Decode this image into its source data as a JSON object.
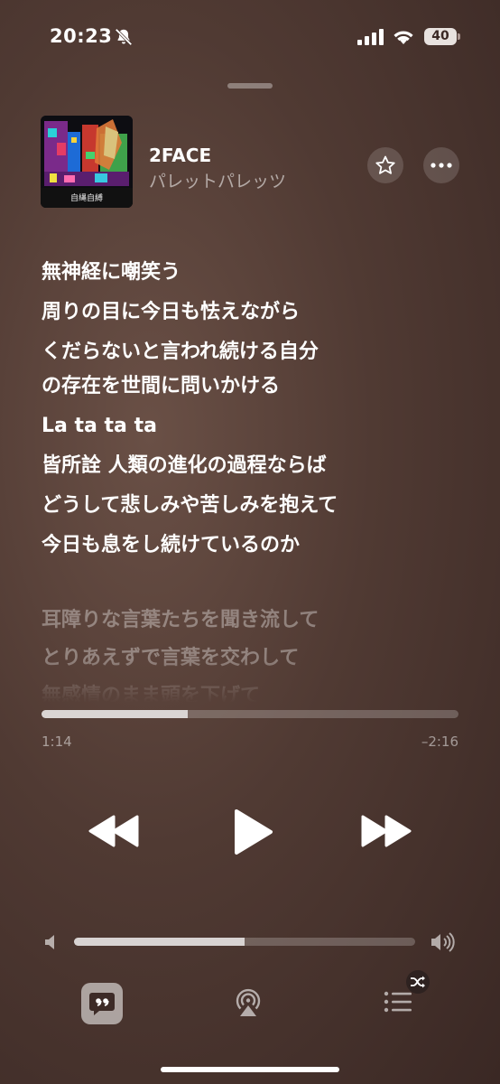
{
  "status_bar": {
    "time": "20:23",
    "battery": "40"
  },
  "track": {
    "title": "2FACE",
    "artist": "パレットパレッツ",
    "artwork_caption": "自縄自縛"
  },
  "lyrics": {
    "active": [
      "無神経に嘲笑う",
      "周りの目に今日も怯えながら",
      "くだらないと言われ続ける自分",
      "の存在を世間に問いかける",
      "La ta ta ta",
      "皆所詮 人類の進化の過程ならば",
      "どうして悲しみや苦しみを抱えて",
      "今日も息をし続けているのか"
    ],
    "upcoming": [
      "耳障りな言葉たちを聞き流して",
      "とりあえずで言葉を交わして",
      "無感情のまま頭を下げて"
    ]
  },
  "playback": {
    "elapsed": "1:14",
    "remaining": "–2:16",
    "progress": 0.35
  },
  "volume": {
    "level": 0.5
  },
  "icons": {
    "mute": "bell-slash-icon",
    "favorite": "star-icon",
    "more": "ellipsis-icon",
    "rewind": "backward-icon",
    "play": "play-icon",
    "forward": "forward-icon",
    "lyrics": "quote-bubble-icon",
    "airplay": "airplay-icon",
    "queue": "list-icon",
    "shuffle": "shuffle-icon"
  }
}
